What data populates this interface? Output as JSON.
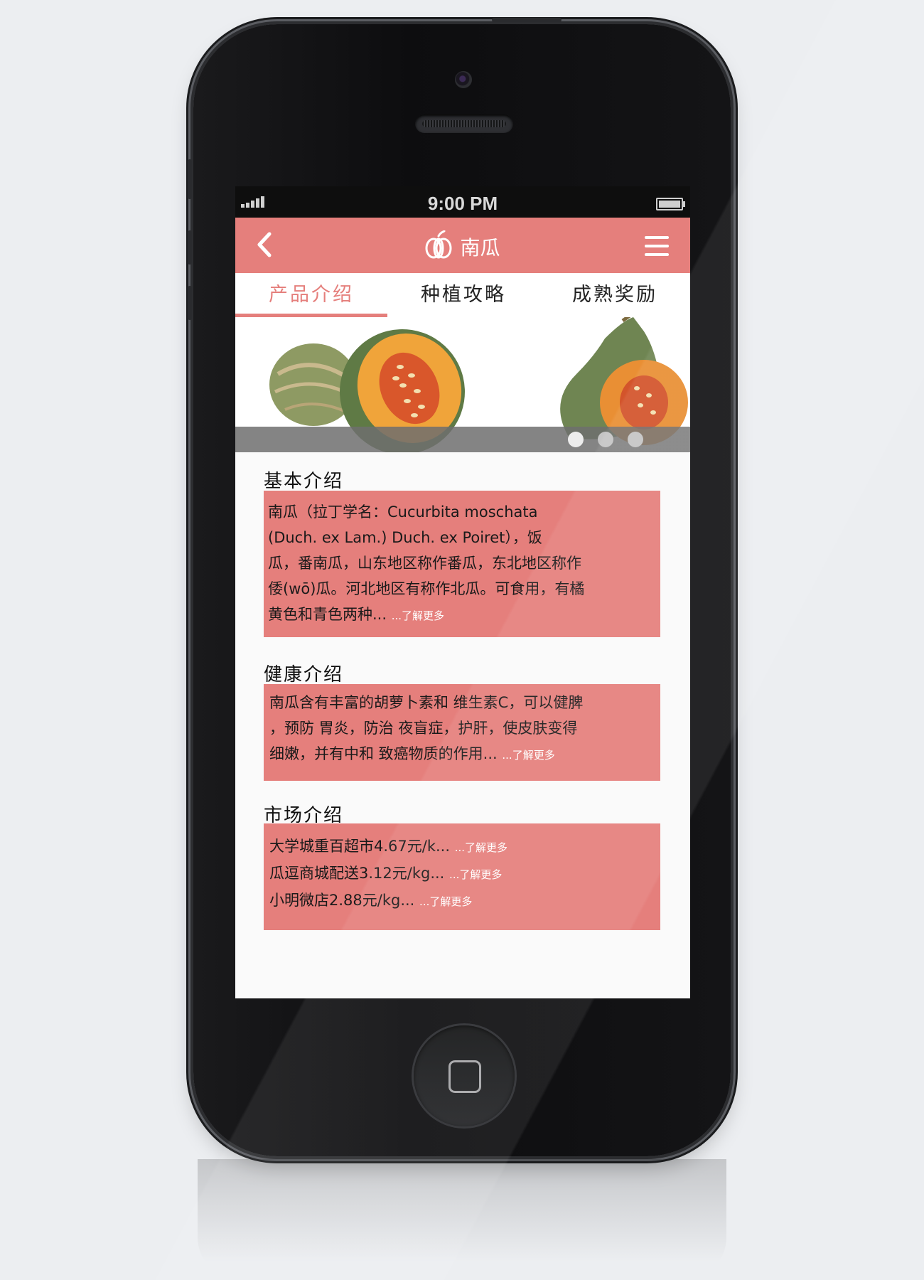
{
  "status": {
    "time": "9:00 PM"
  },
  "header": {
    "title": "南瓜",
    "back_icon": "chevron-left-icon",
    "menu_icon": "hamburger-menu-icon",
    "logo_icon": "pumpkin-logo-icon"
  },
  "tabs": [
    {
      "label": "产品介绍",
      "active": true
    },
    {
      "label": "种植攻略",
      "active": false
    },
    {
      "label": "成熟奖励",
      "active": false
    }
  ],
  "carousel": {
    "slide_count": 3,
    "active_index": 0
  },
  "sections": [
    {
      "title": "基本介绍",
      "lines": [
        "南瓜（拉丁学名：Cucurbita moschata",
        "(Duch. ex Lam.) Duch. ex Poiret），饭",
        "瓜，番南瓜，山东地区称作番瓜，东北地区称作",
        "倭(wō)瓜。河北地区有称作北瓜。可食用，有橘",
        "黄色和青色两种..."
      ],
      "more": "...了解更多"
    },
    {
      "title": "健康介绍",
      "lines": [
        "南瓜含有丰富的胡萝卜素和 维生素C，可以健脾",
        "，预防 胃炎，防治 夜盲症，护肝，使皮肤变得",
        "细嫩，并有中和 致癌物质的作用..."
      ],
      "more": "...了解更多"
    },
    {
      "title": "市场介绍",
      "items": [
        {
          "text": "大学城重百超市4.67元/k...",
          "more": "...了解更多"
        },
        {
          "text": "瓜逗商城配送3.12元/kg...",
          "more": "...了解更多"
        },
        {
          "text": "小明微店2.88元/kg...",
          "more": "...了解更多"
        }
      ]
    }
  ],
  "colors": {
    "accent": "#e57f7c",
    "bezel": "#111113",
    "background": "#eceef1"
  }
}
